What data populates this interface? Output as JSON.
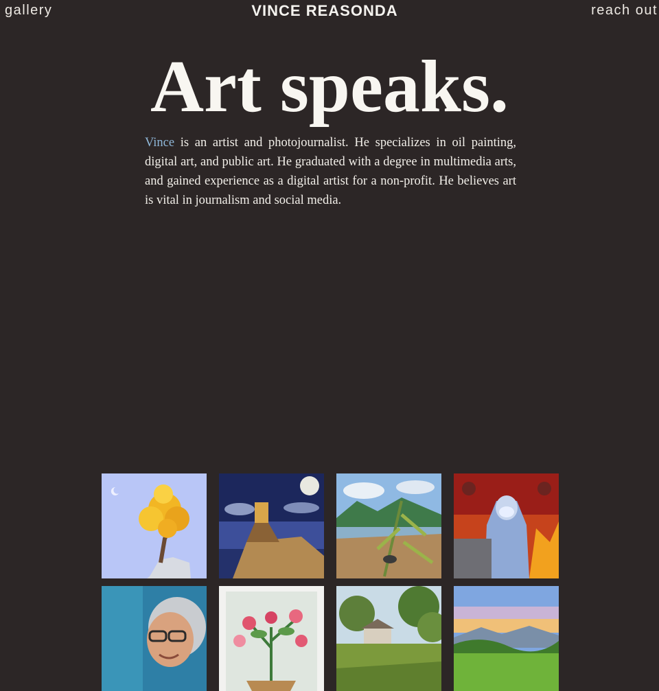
{
  "header": {
    "gallery_label": "gallery",
    "brand": "VINCE REASONDA",
    "reach_label": "reach out"
  },
  "hero": {
    "title": "Art speaks."
  },
  "bio": {
    "name_link": "Vince",
    "text": " is an artist and photojournalist. He specializes in oil painting, digital art, and public art. He graduated with a degree in multimedia arts, and gained experience as a digital artist for a non-profit. He believes art is vital in journalism and social media."
  },
  "colors": {
    "background": "#2c2626",
    "text": "#f5f3ef",
    "link": "#8fb7d8"
  },
  "gallery": {
    "artworks": [
      {
        "name": "artwork-golden-tree"
      },
      {
        "name": "artwork-night-door"
      },
      {
        "name": "artwork-river-landscape"
      },
      {
        "name": "artwork-ppe-worker"
      },
      {
        "name": "artwork-portrait-glasses"
      },
      {
        "name": "artwork-flower-pot"
      },
      {
        "name": "artwork-house-trees"
      },
      {
        "name": "artwork-sunset-field"
      }
    ]
  }
}
